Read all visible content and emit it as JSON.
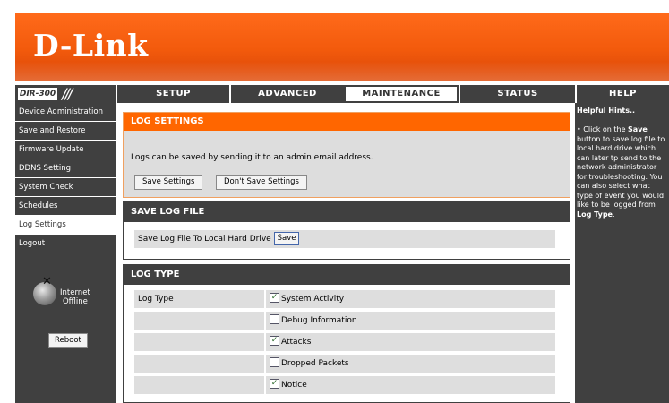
{
  "brand": {
    "logo_text": "D-Link",
    "model": "DIR-300",
    "model_slashes": "///"
  },
  "nav": {
    "tabs": [
      {
        "label": "SETUP",
        "active": false
      },
      {
        "label": "ADVANCED",
        "active": false
      },
      {
        "label": "MAINTENANCE",
        "active": true
      },
      {
        "label": "STATUS",
        "active": false
      },
      {
        "label": "HELP",
        "active": false
      }
    ]
  },
  "sidebar": {
    "items": [
      {
        "label": "Device Administration",
        "active": false
      },
      {
        "label": "Save and Restore",
        "active": false
      },
      {
        "label": "Firmware Update",
        "active": false
      },
      {
        "label": "DDNS Setting",
        "active": false
      },
      {
        "label": "System Check",
        "active": false
      },
      {
        "label": "Schedules",
        "active": false
      },
      {
        "label": "Log Settings",
        "active": true
      },
      {
        "label": "Logout",
        "active": false
      }
    ],
    "status_line1": "Internet",
    "status_line2": "Offline",
    "reboot_label": "Reboot"
  },
  "log_settings": {
    "header": "LOG SETTINGS",
    "description": "Logs can be saved by sending it to an admin email address.",
    "save_settings_label": "Save Settings",
    "dont_save_label": "Don't Save Settings"
  },
  "save_log_file": {
    "header": "SAVE LOG FILE",
    "row_label": "Save Log File To Local Hard Drive",
    "save_label": "Save"
  },
  "log_type": {
    "header": "LOG TYPE",
    "label": "Log Type",
    "options": [
      {
        "label": "System Activity",
        "checked": true
      },
      {
        "label": "Debug Information",
        "checked": false
      },
      {
        "label": "Attacks",
        "checked": true
      },
      {
        "label": "Dropped Packets",
        "checked": false
      },
      {
        "label": "Notice",
        "checked": true
      }
    ]
  },
  "help": {
    "title": "Helpful Hints..",
    "bullet": "•",
    "text_before": " Click on the ",
    "bold1": "Save",
    "text_middle": " button to save log file to local hard drive which can later tp send to the network administrator for troubleshooting. You can also select what type of event you would like to be logged from ",
    "bold2": "Log Type",
    "text_end": "."
  },
  "colors": {
    "accent": "#ff6600",
    "dark": "#404040",
    "row": "#dedede"
  }
}
